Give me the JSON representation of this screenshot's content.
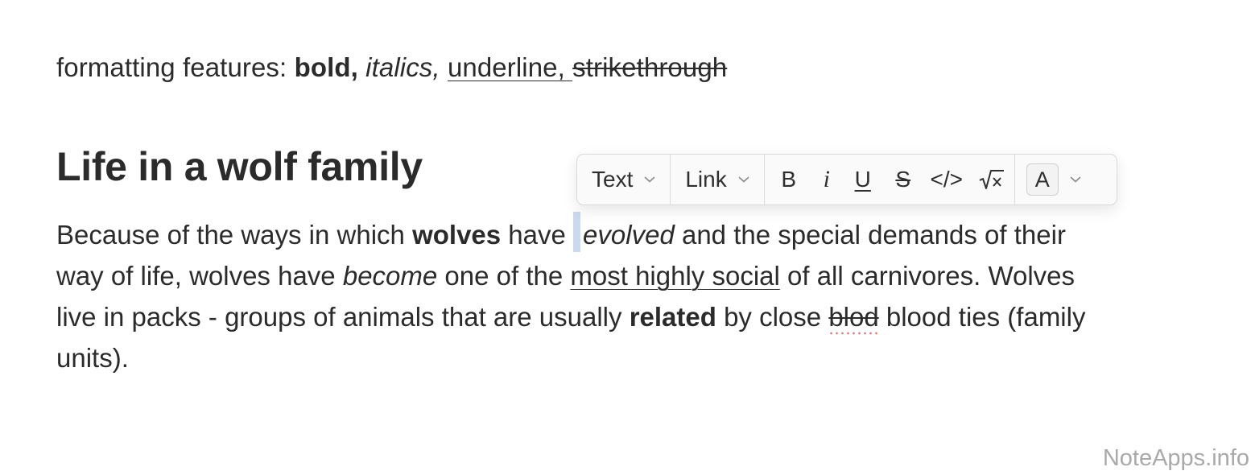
{
  "line1": {
    "prefix": "formatting features: ",
    "bold": "bold,",
    "space1": " ",
    "italic": "italics,",
    "space2": " ",
    "underline": "underline, ",
    "strike": "strikethrough"
  },
  "heading": "Life in a wolf family",
  "paragraph": {
    "r1_a": "Because of the ways in which ",
    "r1_bold": "wolves",
    "r1_b": " have ",
    "r1_italic": "evolved",
    "r1_c": " and the special demands of their",
    "r2_a": "way of life, wolves have ",
    "r2_italic": "become",
    "r2_b": " one of the ",
    "r2_underline": "most highly social",
    "r2_c": " of all carnivores. Wolves",
    "r3_a": "live in packs - groups of animals that are usually ",
    "r3_bold": "related",
    "r3_b": " by close ",
    "r3_strike": "blod",
    "r3_c": " blood ties (family",
    "r4": "units)."
  },
  "toolbar": {
    "text_dropdown": "Text",
    "link_dropdown": "Link",
    "bold": "B",
    "italic": "i",
    "underline": "U",
    "strikethrough": "S",
    "code": "</>",
    "color": "A"
  },
  "watermark": "NoteApps.info",
  "colors": {
    "caret_highlight": "#cbd9ee",
    "spell_error": "#d77b7b",
    "text": "#2b2b2b"
  }
}
